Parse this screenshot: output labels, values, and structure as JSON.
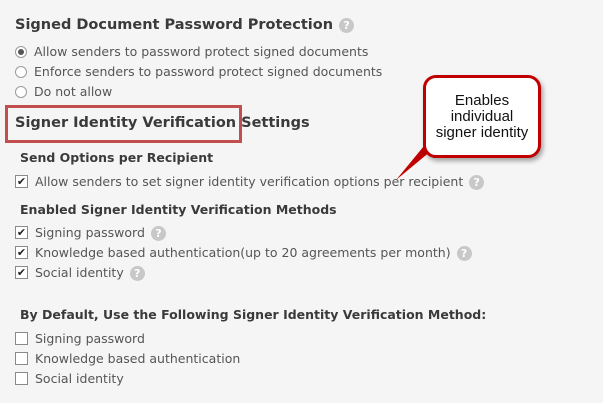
{
  "password_protection": {
    "title": "Signed Document Password Protection",
    "options": [
      {
        "label": "Allow senders to password protect signed documents",
        "selected": true
      },
      {
        "label": "Enforce senders to password protect signed documents",
        "selected": false
      },
      {
        "label": "Do not allow",
        "selected": false
      }
    ]
  },
  "identity_settings": {
    "title": "Signer Identity Verification Settings"
  },
  "send_options": {
    "title": "Send Options per Recipient",
    "allow_label": "Allow senders to set signer identity verification options per recipient",
    "allow_checked": true
  },
  "enabled_methods": {
    "title": "Enabled Signer Identity Verification Methods",
    "items": [
      {
        "label": "Signing password",
        "checked": true
      },
      {
        "label": "Knowledge based authentication(up to 20 agreements per month)",
        "checked": true
      },
      {
        "label": "Social identity",
        "checked": true
      }
    ]
  },
  "default_method": {
    "title": "By Default, Use the Following Signer Identity Verification Method:",
    "items": [
      {
        "label": "Signing password",
        "checked": false
      },
      {
        "label": "Knowledge based authentication",
        "checked": false
      },
      {
        "label": "Social identity",
        "checked": false
      }
    ]
  },
  "callout": {
    "text": "Enables individual signer identity"
  },
  "icons": {
    "help": "?",
    "check": "✔"
  },
  "colors": {
    "highlight_border": "#c0504d",
    "callout_border": "#c00000"
  }
}
